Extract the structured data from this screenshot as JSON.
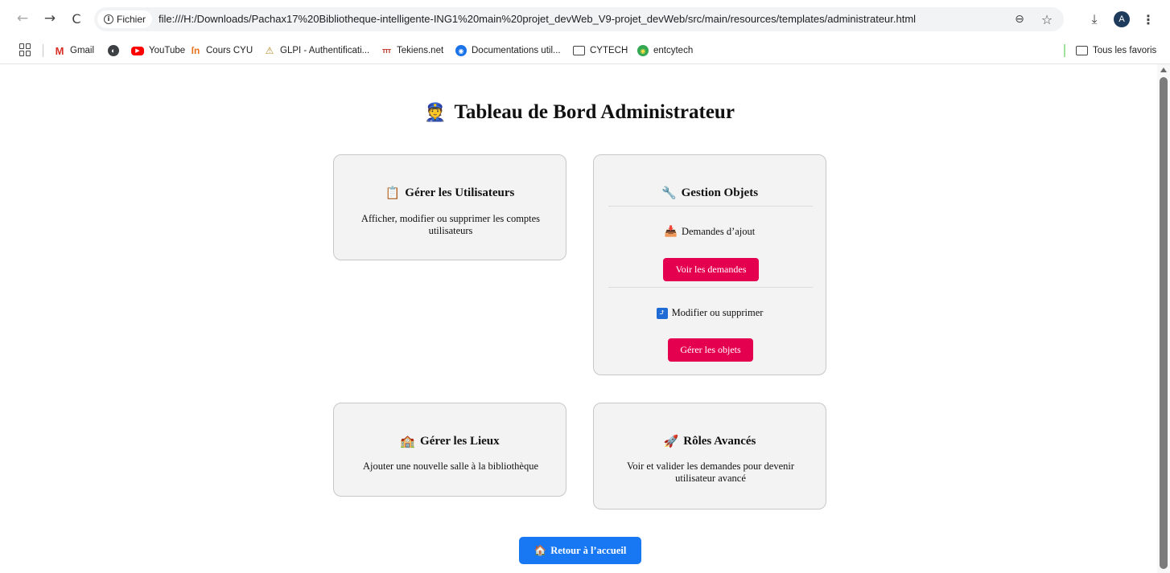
{
  "browser": {
    "chip_label": "Fichier",
    "url": "file:///H:/Downloads/Pachax17%20Bibliotheque-intelligente-ING1%20main%20projet_devWeb_V9-projet_devWeb/src/main/resources/templates/administrateur.html",
    "avatar_letter": "A",
    "icons": {
      "back": "←",
      "forward": "→",
      "reload": "C",
      "info": "i",
      "zoom": "⊖",
      "star": "☆",
      "download": "⤓",
      "menu": "⋮"
    }
  },
  "bookmarks": {
    "items": [
      {
        "label": "Gmail",
        "icon": "M"
      },
      {
        "label": "",
        "icon": "◐"
      },
      {
        "label": "YouTube",
        "icon": "▶"
      },
      {
        "label": "Cours CYU",
        "icon": "ſn"
      },
      {
        "label": "GLPI - Authentificati...",
        "icon": "⚠"
      },
      {
        "label": "Tekiens.net",
        "icon": "ттт"
      },
      {
        "label": "Documentations util...",
        "icon": "◉"
      },
      {
        "label": "CYTECH",
        "icon": ""
      },
      {
        "label": "entcytech",
        "icon": "◉"
      }
    ],
    "right_folder": "Tous les favoris"
  },
  "page": {
    "title": "Tableau de Bord Administrateur",
    "title_emoji": "👮",
    "cards": {
      "users": {
        "emoji": "📋",
        "title": "Gérer les Utilisateurs",
        "desc": "Afficher, modifier ou supprimer les comptes utilisateurs"
      },
      "objets": {
        "emoji": "🔧",
        "title": "Gestion Objets",
        "sub1_emoji": "📥",
        "sub1": "Demandes d’ajout",
        "btn1": "Voir les demandes",
        "sub2_emoji": "⤴",
        "sub2": "Modifier ou supprimer",
        "btn2": "Gérer les objets"
      },
      "lieux": {
        "emoji": "🏫",
        "title": "Gérer les Lieux",
        "desc": "Ajouter une nouvelle salle à la bibliothèque"
      },
      "roles": {
        "emoji": "🚀",
        "title": "Rôles Avancés",
        "desc": "Voir et valider les demandes pour devenir utilisateur avancé"
      }
    },
    "home_button": {
      "emoji": "🏠",
      "label": "Retour à l’accueil"
    }
  },
  "colors": {
    "pink_button": "#e5004f",
    "blue_button": "#1877f2",
    "card_bg": "#f3f3f3"
  }
}
